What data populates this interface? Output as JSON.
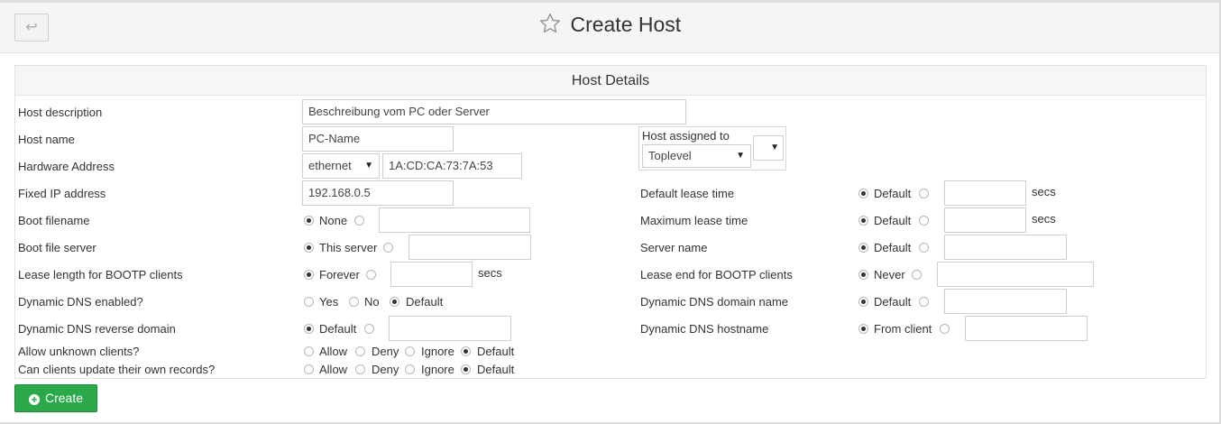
{
  "header": {
    "back_icon": "↩",
    "star_icon": "star-outline-icon",
    "title": "Create Host"
  },
  "panel": {
    "heading": "Host Details"
  },
  "left": {
    "host_description": {
      "label": "Host description",
      "value": "Beschreibung vom PC oder Server"
    },
    "host_name": {
      "label": "Host name",
      "value": "PC-Name"
    },
    "hardware_address": {
      "label": "Hardware Address",
      "type": "ethernet",
      "value": "1A:CD:CA:73:7A:53"
    },
    "fixed_ip": {
      "label": "Fixed IP address",
      "value": "192.168.0.5"
    },
    "boot_filename": {
      "label": "Boot filename",
      "option": "None",
      "value": ""
    },
    "boot_file_server": {
      "label": "Boot file server",
      "option": "This server",
      "value": ""
    },
    "lease_length": {
      "label": "Lease length for BOOTP clients",
      "option": "Forever",
      "value": "",
      "unit": "secs"
    },
    "ddns_enabled": {
      "label": "Dynamic DNS enabled?",
      "options": [
        "Yes",
        "No",
        "Default"
      ]
    },
    "ddns_reverse": {
      "label": "Dynamic DNS reverse domain",
      "option": "Default",
      "value": ""
    },
    "allow_unknown": {
      "label": "Allow unknown clients?",
      "options": [
        "Allow",
        "Deny",
        "Ignore",
        "Default"
      ]
    },
    "update_records": {
      "label": "Can clients update their own records?",
      "options": [
        "Allow",
        "Deny",
        "Ignore",
        "Default"
      ]
    }
  },
  "right": {
    "host_assigned": {
      "label": "Host assigned to",
      "value": "Toplevel",
      "second_value": ""
    },
    "default_lease": {
      "label": "Default lease time",
      "option": "Default",
      "value": "",
      "unit": "secs"
    },
    "max_lease": {
      "label": "Maximum lease time",
      "option": "Default",
      "value": "",
      "unit": "secs"
    },
    "server_name": {
      "label": "Server name",
      "option": "Default",
      "value": ""
    },
    "lease_end": {
      "label": "Lease end for BOOTP clients",
      "option": "Never",
      "value": ""
    },
    "ddns_domain": {
      "label": "Dynamic DNS domain name",
      "option": "Default",
      "value": ""
    },
    "ddns_hostname": {
      "label": "Dynamic DNS hostname",
      "option": "From client",
      "value": ""
    }
  },
  "actions": {
    "create_label": "Create"
  },
  "colors": {
    "create_button": "#2aa84a",
    "header_bg": "#f5f5f5"
  }
}
